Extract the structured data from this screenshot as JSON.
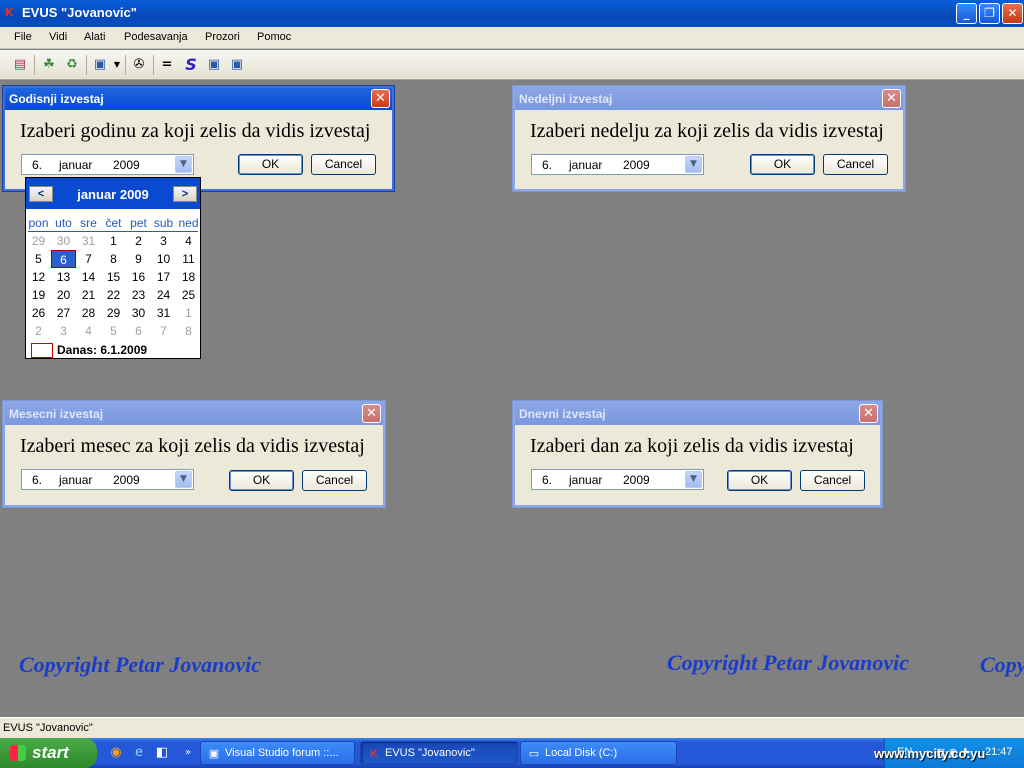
{
  "window": {
    "title": "EVUS \"Jovanovic\"",
    "icon": "app-icon"
  },
  "menu": [
    "File",
    "Vidi",
    "Alati",
    "Podesavanja",
    "Prozori",
    "Pomoc"
  ],
  "dialogs": {
    "godisnji": {
      "title": "Godisnji izvestaj",
      "prompt": "Izaberi godinu za koji zelis da vidis izvestaj",
      "date": {
        "day": "6.",
        "month": "januar",
        "year": "2009"
      },
      "ok": "OK",
      "cancel": "Cancel"
    },
    "nedeljni": {
      "title": "Nedeljni izvestaj",
      "prompt": "Izaberi nedelju za koji zelis da vidis izvestaj",
      "date": {
        "day": "6.",
        "month": "januar",
        "year": "2009"
      },
      "ok": "OK",
      "cancel": "Cancel"
    },
    "mesecni": {
      "title": "Mesecni izvestaj",
      "prompt": "Izaberi mesec za koji zelis da vidis izvestaj",
      "date": {
        "day": "6.",
        "month": "januar",
        "year": "2009"
      },
      "ok": "OK",
      "cancel": "Cancel"
    },
    "dnevni": {
      "title": "Dnevni izvestaj",
      "prompt": "Izaberi dan za koji zelis da vidis izvestaj",
      "date": {
        "day": "6.",
        "month": "januar",
        "year": "2009"
      },
      "ok": "OK",
      "cancel": "Cancel"
    }
  },
  "calendar": {
    "month_title": "januar 2009",
    "weekdays": [
      "pon",
      "uto",
      "sre",
      "čet",
      "pet",
      "sub",
      "ned"
    ],
    "weeks": [
      [
        "29",
        "30",
        "31",
        "1",
        "2",
        "3",
        "4"
      ],
      [
        "5",
        "6",
        "7",
        "8",
        "9",
        "10",
        "11"
      ],
      [
        "12",
        "13",
        "14",
        "15",
        "16",
        "17",
        "18"
      ],
      [
        "19",
        "20",
        "21",
        "22",
        "23",
        "24",
        "25"
      ],
      [
        "26",
        "27",
        "28",
        "29",
        "30",
        "31",
        "1"
      ],
      [
        "2",
        "3",
        "4",
        "5",
        "6",
        "7",
        "8"
      ]
    ],
    "selected": "6",
    "today_label": "Danas: 6.1.2009"
  },
  "copyright": "Copyright  Petar Jovanovic",
  "copyright_partial": "Copy",
  "status_text": "EVUS \"Jovanovic\"",
  "taskbar": {
    "start": "start",
    "tasks": [
      {
        "label": "Visual Studio forum ::...",
        "active": false
      },
      {
        "label": "EVUS \"Jovanovic\"",
        "active": true
      },
      {
        "label": "Local Disk (C:)",
        "active": false
      }
    ],
    "tray_lang": "EN",
    "clock": "21:47",
    "watermark": "www.mycity.co.yu"
  },
  "colors": {
    "desktop": "#808080",
    "title_blue": "#0a4ad0",
    "copyright": "#1a3ccc"
  }
}
